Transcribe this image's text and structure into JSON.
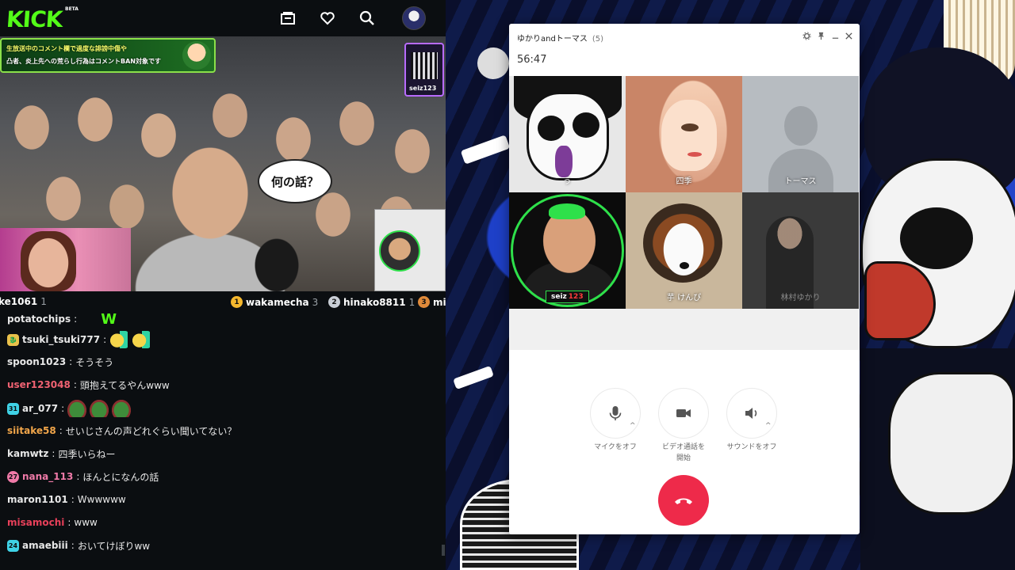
{
  "kick": {
    "logo": "KICK",
    "beta": "BETA",
    "banner": {
      "line1": "生放送中のコメント欄で過度な誹謗中傷や",
      "line2": "凸者、炎上先への荒らし行為はコメントBAN対象です"
    },
    "qr_label": "seiz123",
    "speech_bubble": "何の話？",
    "leaderboard": [
      {
        "name": "ke1061",
        "count": "1"
      },
      {
        "rank": "1",
        "name": "wakamecha",
        "count": "3",
        "color": "#f5b82e"
      },
      {
        "rank": "2",
        "name": "hinako8811",
        "count": "1",
        "color": "#c9ced6"
      },
      {
        "rank": "3",
        "name": "mi",
        "count": "",
        "color": "#e08a3a"
      }
    ],
    "chat": [
      {
        "user": "potatochips",
        "message": "W",
        "user_color": "#e8e8e8"
      },
      {
        "user": "tsuki_tsuki777",
        "message": "",
        "user_color": "#e8e8e8",
        "badge": "dragon"
      },
      {
        "user": "spoon1023",
        "message": "そうそう",
        "user_color": "#e8e8e8"
      },
      {
        "user": "user123048",
        "message": "頭抱えてるやんwww",
        "user_color": "#f06272"
      },
      {
        "user": "ar_077",
        "message": "",
        "user_color": "#e8e8e8",
        "badge": "31"
      },
      {
        "user": "siitake58",
        "message": "せいじさんの声どれぐらい聞いてない？",
        "user_color": "#f2a64a"
      },
      {
        "user": "kamwtz",
        "message": "四季いらねー",
        "user_color": "#e8e8e8"
      },
      {
        "user": "nana_113",
        "message": "ほんとになんの話",
        "user_color": "#f07aa8",
        "badge": "27"
      },
      {
        "user": "maron1101",
        "message": "Wwwwww",
        "user_color": "#e8e8e8"
      },
      {
        "user": "misamochi",
        "message": "www",
        "user_color": "#e8405a"
      },
      {
        "user": "amaebiii",
        "message": "おいてけぼりww",
        "user_color": "#e8e8e8",
        "badge": "24"
      }
    ]
  },
  "call": {
    "title": "ゆかりandトーマス",
    "count": "(5)",
    "timer": "56:47",
    "participants": [
      {
        "name": "う"
      },
      {
        "name": "四季"
      },
      {
        "name": "トーマス"
      },
      {
        "name": "seiz",
        "tag": "123"
      },
      {
        "name": "芋 けんぴ"
      },
      {
        "name": "林村ゆかり"
      }
    ],
    "controls": [
      {
        "label1": "マイクをオフ",
        "label2": ""
      },
      {
        "label1": "ビデオ通話を",
        "label2": "開始"
      },
      {
        "label1": "サウンドをオフ",
        "label2": ""
      }
    ],
    "caret": "^"
  },
  "colors": {
    "kick_green": "#53fc18",
    "hangup_red": "#ee2a4a",
    "active_ring": "#2ee04a"
  }
}
